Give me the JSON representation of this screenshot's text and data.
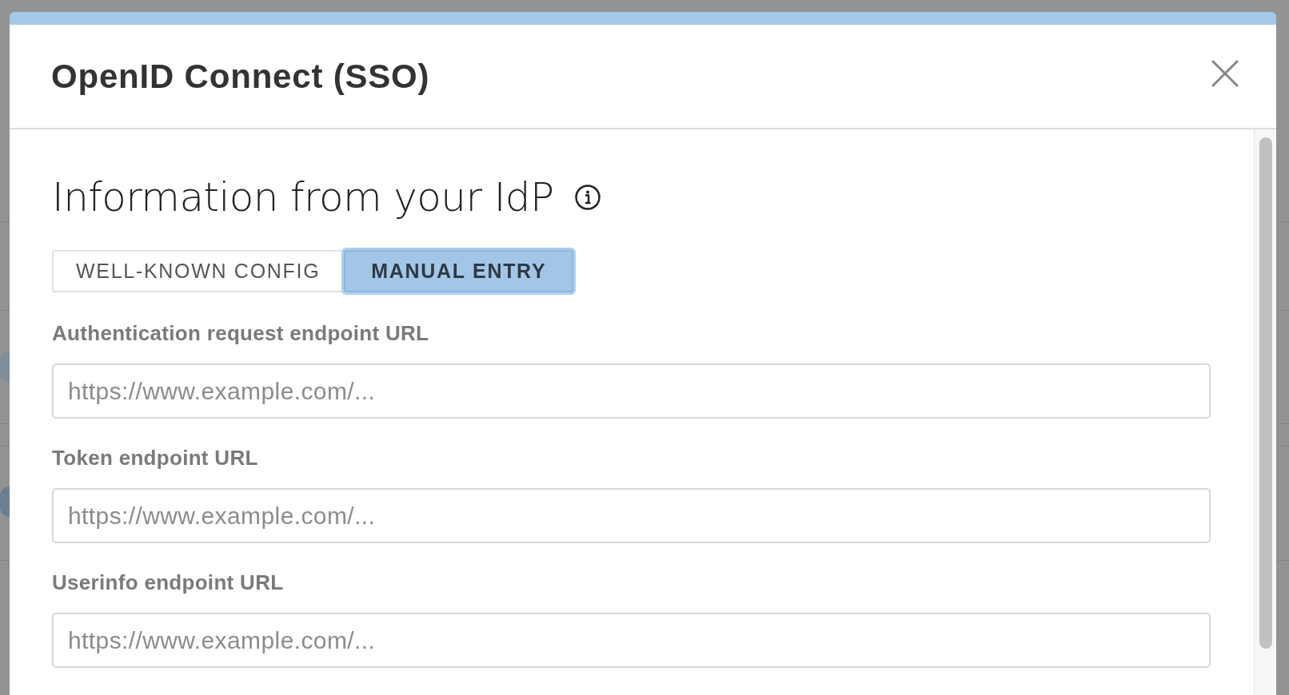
{
  "dialog": {
    "title": "OpenID Connect (SSO)"
  },
  "section": {
    "heading": "Information from your IdP"
  },
  "tabs": [
    {
      "label": "WELL-KNOWN CONFIG",
      "selected": false
    },
    {
      "label": "MANUAL ENTRY",
      "selected": true
    }
  ],
  "fields": [
    {
      "label": "Authentication request endpoint URL",
      "placeholder": "https://www.example.com/..."
    },
    {
      "label": "Token endpoint URL",
      "placeholder": "https://www.example.com/..."
    },
    {
      "label": "Userinfo endpoint URL",
      "placeholder": "https://www.example.com/..."
    }
  ]
}
